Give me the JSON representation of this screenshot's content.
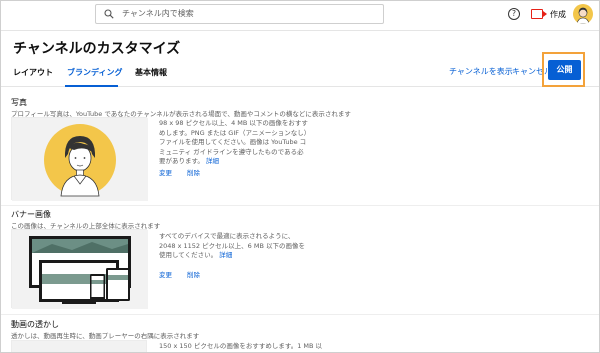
{
  "search": {
    "placeholder": "チャンネル内で検索"
  },
  "topbar": {
    "help_glyph": "?",
    "create_label": "作成"
  },
  "header": {
    "title": "チャンネルのカスタマイズ",
    "tabs": [
      {
        "label": "レイアウト",
        "active": false
      },
      {
        "label": "ブランディング",
        "active": true
      },
      {
        "label": "基本情報",
        "active": false
      }
    ],
    "view_channel": "チャンネルを表示",
    "cancel": "キャンセル",
    "publish": "公開"
  },
  "photo": {
    "title": "写真",
    "description": "プロフィール写真は、YouTube であなたのチャンネルが表示される場面で、動画やコメントの横などに表示されます",
    "info": "98 x 98 ピクセル以上、4 MB 以下の画像をおすすめします。PNG または GIF（アニメーションなし）ファイルを使用してください。画像は YouTube コミュニティ ガイドラインを遵守したものである必要があります。",
    "more": "詳細",
    "change": "変更",
    "delete": "削除"
  },
  "banner": {
    "title": "バナー画像",
    "description": "この画像は、チャンネルの上部全体に表示されます",
    "info": "すべてのデバイスで最適に表示されるように、2048 x 1152 ピクセル以上、6 MB 以下の画像を使用してください。",
    "more": "詳細",
    "change": "変更",
    "delete": "削除"
  },
  "watermark": {
    "title": "動画の透かし",
    "description": "透かしは、動画再生時に、動画プレーヤーの右隅に表示されます",
    "info": "150 x 150 ピクセルの画像をおすすめします。1 MB 以"
  },
  "colors": {
    "accent": "#065fd4",
    "highlight": "#f3a23a",
    "avatar_bg": "#f3c64a",
    "create_icon": "#e62117"
  }
}
